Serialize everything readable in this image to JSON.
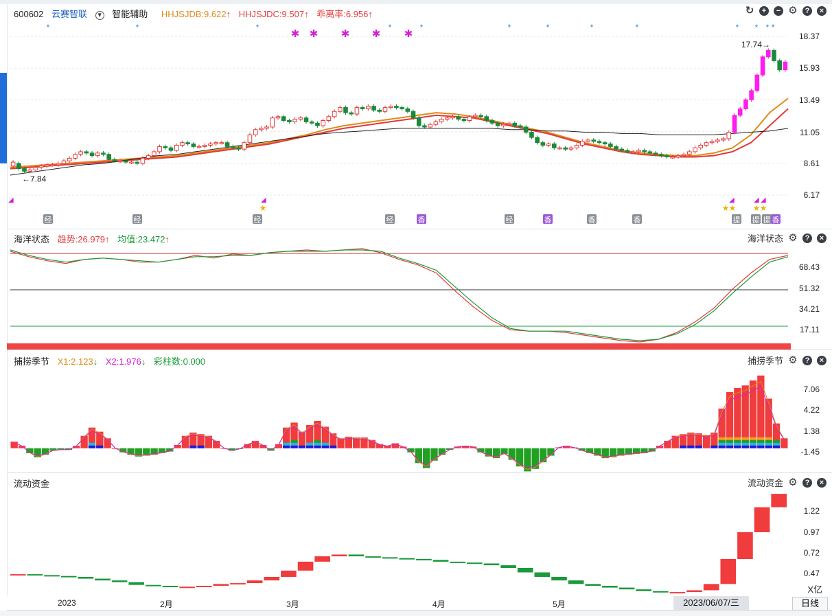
{
  "main": {
    "stock_code": "600602",
    "stock_name": "云赛智联",
    "assist_label": "智能辅助",
    "indicators": [
      {
        "label": "HHJSJDB:9.622",
        "color": "#e08a1a"
      },
      {
        "label": "HHJSJDC:9.507",
        "color": "#e23a3a"
      },
      {
        "label": "乖离率:6.956",
        "color": "#e23a3a"
      }
    ],
    "price_ticks": [
      "18.37",
      "15.93",
      "13.49",
      "11.05",
      "8.61",
      "6.17"
    ],
    "max_label": "17.74→",
    "min_label": "←7.84",
    "badges": [
      {
        "text": "经",
        "kind": "gray"
      },
      {
        "text": "经",
        "kind": "gray"
      },
      {
        "text": "经",
        "kind": "gray"
      },
      {
        "text": "经",
        "kind": "gray"
      },
      {
        "text": "香",
        "kind": "purple"
      },
      {
        "text": "经",
        "kind": "gray"
      },
      {
        "text": "香",
        "kind": "purple"
      },
      {
        "text": "香",
        "kind": "gray"
      },
      {
        "text": "香",
        "kind": "gray"
      },
      {
        "text": "提",
        "kind": "gray"
      },
      {
        "text": "提",
        "kind": "gray"
      },
      {
        "text": "提",
        "kind": "gray"
      },
      {
        "text": "香",
        "kind": "purple"
      }
    ]
  },
  "ocean": {
    "title": "海洋状态",
    "trend_label": "趋势:26.979",
    "avg_label": "均值:23.472",
    "title_right": "海洋状态",
    "ticks": [
      "68.43",
      "51.32",
      "34.21",
      "17.11"
    ]
  },
  "season": {
    "title": "捕捞季节",
    "x1_label": "X1:2.123",
    "x2_label": "X2:1.976",
    "color_label": "彩柱数:0.000",
    "title_right": "捕捞季节",
    "ticks": [
      "7.06",
      "4.22",
      "1.38",
      "-1.45"
    ]
  },
  "flow": {
    "title": "流动资金",
    "title_right": "流动资金",
    "ticks": [
      "1.22",
      "0.97",
      "0.72",
      "0.47"
    ],
    "unit": "X亿"
  },
  "time_axis": {
    "labels": [
      "2023",
      "2月",
      "3月",
      "4月",
      "5月"
    ],
    "cursor_date": "2023/06/07/三",
    "period_button": "日线"
  },
  "chart_data": [
    {
      "type": "candlestick",
      "title": "600602 云赛智联",
      "ylim": [
        6.17,
        18.37
      ],
      "yticks": [
        18.37,
        15.93,
        13.49,
        11.05,
        8.61,
        6.17
      ],
      "x": [
        "2023",
        "2月",
        "3月",
        "4月",
        "5月"
      ],
      "close": [
        8.7,
        8.2,
        8.0,
        8.1,
        8.3,
        8.4,
        8.5,
        8.5,
        8.6,
        8.8,
        9.0,
        9.3,
        9.5,
        9.4,
        9.2,
        9.4,
        9.3,
        8.9,
        8.8,
        8.8,
        8.7,
        8.7,
        8.6,
        9.0,
        9.2,
        9.5,
        9.9,
        9.8,
        9.6,
        10.0,
        10.2,
        10.1,
        9.9,
        9.9,
        10.0,
        10.1,
        10.2,
        10.2,
        9.9,
        9.8,
        9.7,
        10.2,
        10.8,
        11.2,
        11.3,
        11.4,
        12.1,
        12.2,
        11.9,
        11.8,
        12.0,
        12.1,
        11.8,
        11.7,
        11.5,
        11.9,
        12.2,
        12.6,
        12.9,
        12.5,
        12.4,
        12.9,
        12.8,
        13.0,
        12.7,
        12.6,
        12.9,
        13.0,
        12.9,
        12.8,
        12.6,
        12.1,
        11.5,
        11.4,
        11.6,
        11.8,
        12.0,
        12.1,
        12.2,
        12.0,
        11.9,
        12.2,
        12.3,
        12.2,
        11.9,
        11.7,
        11.5,
        11.6,
        11.7,
        11.5,
        11.4,
        11.0,
        10.6,
        10.2,
        10.0,
        10.1,
        9.8,
        9.8,
        9.7,
        9.8,
        10.0,
        10.3,
        10.4,
        10.3,
        10.2,
        10.1,
        9.9,
        9.7,
        9.6,
        9.5,
        9.5,
        9.6,
        9.5,
        9.4,
        9.3,
        9.2,
        9.1,
        9.1,
        9.2,
        9.3,
        9.5,
        9.8,
        10.0,
        10.2,
        10.3,
        10.4,
        10.5,
        11.0,
        12.3,
        12.8,
        13.5,
        14.2,
        15.4,
        16.8,
        17.3,
        16.5,
        15.8,
        16.4
      ],
      "open": [
        8.4,
        8.6,
        8.2,
        8.0,
        8.1,
        8.3,
        8.4,
        8.5,
        8.5,
        8.6,
        8.8,
        9.0,
        9.3,
        9.5,
        9.4,
        9.2,
        9.4,
        9.3,
        8.9,
        8.8,
        8.8,
        8.7,
        8.7,
        8.6,
        9.0,
        9.2,
        9.5,
        9.9,
        9.8,
        9.6,
        10.0,
        10.2,
        10.1,
        9.9,
        9.9,
        10.0,
        10.1,
        10.2,
        10.2,
        9.9,
        9.8,
        9.7,
        10.2,
        10.8,
        11.2,
        11.3,
        11.4,
        12.1,
        12.2,
        11.9,
        11.8,
        12.0,
        12.1,
        11.8,
        11.7,
        11.5,
        11.9,
        12.2,
        12.6,
        12.9,
        12.5,
        12.4,
        12.9,
        12.8,
        13.0,
        12.7,
        12.6,
        12.9,
        13.0,
        12.9,
        12.8,
        12.6,
        12.1,
        11.5,
        11.4,
        11.6,
        11.8,
        12.0,
        12.1,
        12.2,
        12.0,
        11.9,
        12.2,
        12.3,
        12.2,
        11.9,
        11.7,
        11.5,
        11.6,
        11.7,
        11.5,
        11.4,
        11.0,
        10.6,
        10.2,
        10.0,
        10.1,
        9.8,
        9.8,
        9.7,
        9.8,
        10.0,
        10.3,
        10.4,
        10.3,
        10.2,
        10.1,
        9.9,
        9.7,
        9.6,
        9.5,
        9.5,
        9.6,
        9.5,
        9.4,
        9.3,
        9.2,
        9.1,
        9.1,
        9.2,
        9.3,
        9.5,
        9.8,
        10.0,
        10.2,
        10.3,
        10.4,
        10.5,
        11.0,
        12.3,
        12.8,
        13.5,
        14.2,
        15.4,
        16.8,
        17.3,
        16.5,
        15.8
      ],
      "max_price": 17.74,
      "min_price": 7.84,
      "series": [
        {
          "name": "HHJSJDB",
          "color": "#e08a1a",
          "values": [
            8.3,
            8.4,
            8.5,
            8.6,
            8.7,
            8.8,
            8.9,
            9.0,
            9.1,
            9.2,
            9.4,
            9.6,
            9.8,
            10.0,
            10.2,
            10.5,
            10.8,
            11.2,
            11.5,
            11.7,
            11.9,
            12.1,
            12.3,
            12.5,
            12.4,
            12.2,
            11.9,
            11.6,
            11.3,
            11.0,
            10.6,
            10.2,
            9.9,
            9.6,
            9.4,
            9.3,
            9.2,
            9.2,
            9.4,
            9.8,
            10.8,
            12.5,
            13.6
          ]
        },
        {
          "name": "HHJSJDC",
          "color": "#e23a3a",
          "values": [
            8.2,
            8.3,
            8.4,
            8.5,
            8.6,
            8.7,
            8.8,
            8.9,
            9.0,
            9.1,
            9.3,
            9.5,
            9.7,
            9.9,
            10.1,
            10.4,
            10.7,
            11.0,
            11.3,
            11.5,
            11.7,
            11.9,
            12.1,
            12.3,
            12.2,
            12.1,
            11.8,
            11.5,
            11.2,
            10.9,
            10.5,
            10.1,
            9.8,
            9.5,
            9.3,
            9.2,
            9.1,
            9.1,
            9.2,
            9.5,
            10.2,
            11.5,
            12.8
          ]
        },
        {
          "name": "MA",
          "color": "#222222",
          "values": [
            7.7,
            7.9,
            8.1,
            8.3,
            8.5,
            8.6,
            8.8,
            9.0,
            9.2,
            9.3,
            9.5,
            9.7,
            9.9,
            10.1,
            10.3,
            10.5,
            10.7,
            10.9,
            11.0,
            11.1,
            11.2,
            11.3,
            11.3,
            11.3,
            11.3,
            11.3,
            11.3,
            11.2,
            11.2,
            11.1,
            11.1,
            11.0,
            11.0,
            10.9,
            10.9,
            10.8,
            10.8,
            10.8,
            10.8,
            10.9,
            11.0,
            11.1,
            11.3
          ]
        }
      ]
    },
    {
      "type": "line",
      "title": "海洋状态",
      "ylim": [
        10,
        78
      ],
      "yticks": [
        68.43,
        51.32,
        34.21,
        17.11
      ],
      "series": [
        {
          "name": "趋势",
          "color": "#e23a3a",
          "values": [
            76,
            72,
            69,
            67,
            70,
            71,
            70,
            68,
            68,
            70,
            73,
            71,
            74,
            73,
            75,
            76,
            77,
            76,
            77,
            78,
            75,
            70,
            66,
            60,
            47,
            35,
            25,
            18,
            17,
            17,
            16,
            14,
            12,
            10,
            9,
            11,
            16,
            24,
            34,
            48,
            60,
            70,
            73
          ]
        },
        {
          "name": "均值",
          "color": "#1a9a3a",
          "values": [
            77,
            73,
            70,
            68,
            70,
            71,
            70,
            69,
            68,
            70,
            72,
            72,
            73,
            73,
            75,
            76,
            76,
            76,
            77,
            77,
            76,
            71,
            67,
            62,
            50,
            38,
            27,
            19,
            17,
            17,
            17,
            15,
            13,
            11,
            10,
            11,
            15,
            22,
            32,
            45,
            57,
            68,
            72
          ]
        }
      ]
    },
    {
      "type": "bar",
      "title": "捕捞季节",
      "ylim": [
        -2.6,
        9.2
      ],
      "yticks": [
        7.06,
        4.22,
        1.38,
        -1.45
      ],
      "values": [
        0.8,
        0.3,
        -0.6,
        -1.1,
        -0.8,
        -0.3,
        -0.2,
        -0.2,
        0.3,
        1.5,
        2.5,
        2.0,
        1.2,
        0.0,
        -0.5,
        -0.8,
        -1.0,
        -0.9,
        -0.8,
        -0.6,
        -0.4,
        0.4,
        1.5,
        1.9,
        1.7,
        1.5,
        0.9,
        0.0,
        -0.3,
        -0.1,
        0.5,
        0.9,
        0.4,
        -0.3,
        0.5,
        2.5,
        3.1,
        2.0,
        2.8,
        3.3,
        2.6,
        1.8,
        1.2,
        1.4,
        1.3,
        1.3,
        1.0,
        0.5,
        0.3,
        0.6,
        0.2,
        -0.5,
        -1.8,
        -2.4,
        -1.5,
        -0.8,
        -0.2,
        0.2,
        0.3,
        0.2,
        -0.5,
        -1.0,
        -1.2,
        -0.7,
        -1.4,
        -2.2,
        -2.8,
        -2.5,
        -1.7,
        -0.9,
        0.1,
        0.3,
        0.1,
        -0.3,
        -0.6,
        -0.9,
        -1.2,
        -1.1,
        -0.9,
        -0.8,
        -0.7,
        -0.6,
        -0.4,
        0.3,
        0.9,
        1.5,
        1.7,
        1.9,
        1.8,
        1.6,
        1.9,
        4.8,
        6.8,
        7.3,
        7.6,
        8.2,
        8.8,
        6.0,
        3.0,
        1.2
      ],
      "series": [
        {
          "name": "X1",
          "color": "#e08a1a"
        },
        {
          "name": "X2",
          "color": "#d61ed6"
        }
      ]
    },
    {
      "type": "bar",
      "title": "流动资金",
      "ylim": [
        0.35,
        1.55
      ],
      "yticks": [
        1.22,
        0.97,
        0.72,
        0.47
      ],
      "values": [
        0.58,
        0.57,
        0.56,
        0.55,
        0.53,
        0.51,
        0.49,
        0.46,
        0.45,
        0.44,
        0.44,
        0.45,
        0.47,
        0.48,
        0.51,
        0.55,
        0.62,
        0.72,
        0.78,
        0.8,
        0.78,
        0.77,
        0.76,
        0.75,
        0.74,
        0.72,
        0.71,
        0.7,
        0.68,
        0.65,
        0.6,
        0.55,
        0.51,
        0.47,
        0.45,
        0.43,
        0.41,
        0.39,
        0.38,
        0.38,
        0.4,
        0.47,
        0.75,
        1.05,
        1.33,
        1.48
      ]
    }
  ]
}
